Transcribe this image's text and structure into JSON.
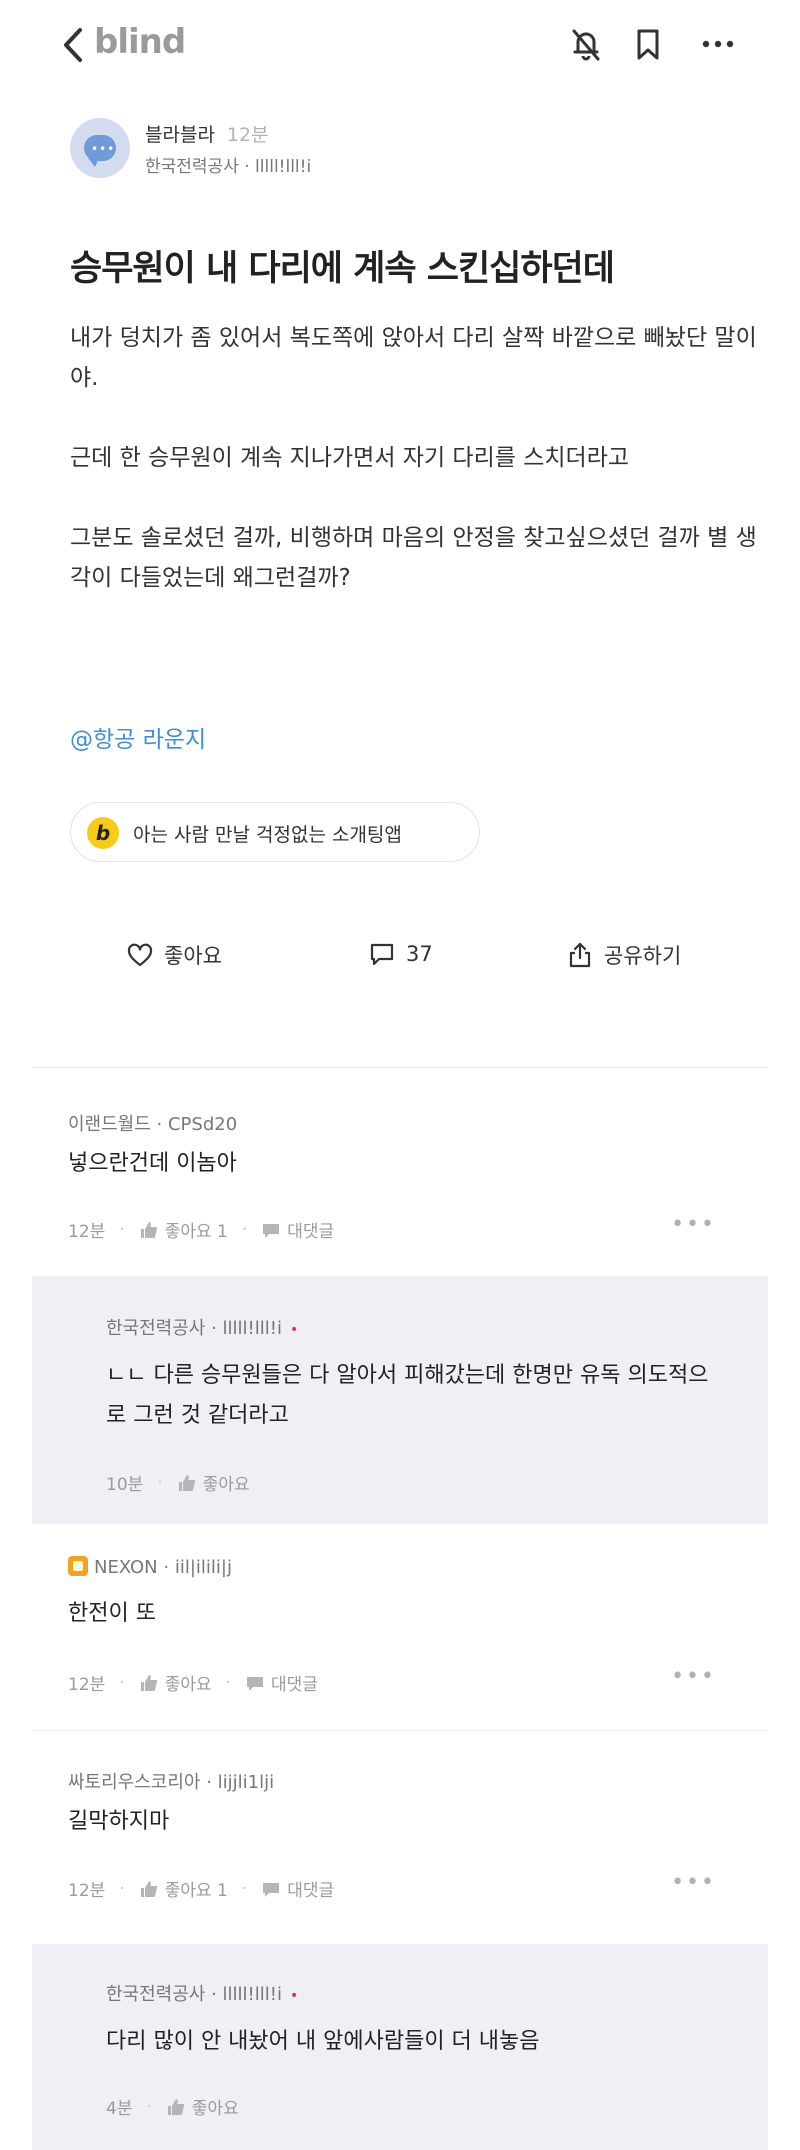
{
  "header": {
    "brand": "blind",
    "icons": [
      "back-icon",
      "notification-off-icon",
      "bookmark-icon",
      "more-icon"
    ]
  },
  "post": {
    "author_name": "블라블라",
    "time": "12분",
    "company": "한국전력공사 · lllll!lll!i",
    "title": "승무원이 내 다리에 계속 스킨십하던데",
    "paragraphs": [
      "내가 덩치가 좀 있어서 복도쪽에 앉아서 다리 살짝 바깥으로 빼놨단 말이야.",
      "근데 한 승무원이 계속 지나가면서 자기 다리를 스치더라고",
      "그분도 솔로셨던 걸까, 비행하며 마음의 안정을 찾고싶으셨던 걸까 별 생각이 다들었는데 왜그런걸까?"
    ],
    "hashtag": "@항공 라운지",
    "ad_badge": "b",
    "ad_text": "아는 사람 만날 걱정없는 소개팅앱"
  },
  "actions": {
    "like_label": "좋아요",
    "comment_count": "37",
    "share_label": "공유하기"
  },
  "comments": [
    {
      "header": "이랜드월드 · CPSd20",
      "text": "넣으란건데 이놈아",
      "time": "12분",
      "like": "좋아요 1",
      "reply": "대댓글"
    },
    {
      "header": "한국전력공사 · lllll!lll!i",
      "author_dot": "•",
      "text": "ㄴㄴ 다른 승무원들은 다 알아서 피해갔는데 한명만 유독 의도적으로 그런 것 같더라고",
      "time": "10분",
      "like": "좋아요"
    },
    {
      "header": "NEXON · iil|ilili|j",
      "text": "한전이 또",
      "time": "12분",
      "like": "좋아요",
      "reply": "대댓글"
    },
    {
      "header": "싸토리우스코리아 · lijjli1lji",
      "text": "길막하지마",
      "time": "12분",
      "like": "좋아요 1",
      "reply": "대댓글"
    },
    {
      "header": "한국전력공사 · lllll!lll!i",
      "author_dot": "•",
      "text": "다리 많이 안 내놨어 내 앞에사람들이 더 내놓음",
      "time": "4분",
      "like": "좋아요"
    }
  ],
  "colors": {
    "brand_gray": "#9a9a9a",
    "hashtag_blue": "#3f8fd4",
    "reply_background": "#eef0f5",
    "author_dot_red": "#e0324b",
    "ad_badge_yellow": "#f6cc19",
    "nexon_badge_orange": "#f2a41f"
  }
}
